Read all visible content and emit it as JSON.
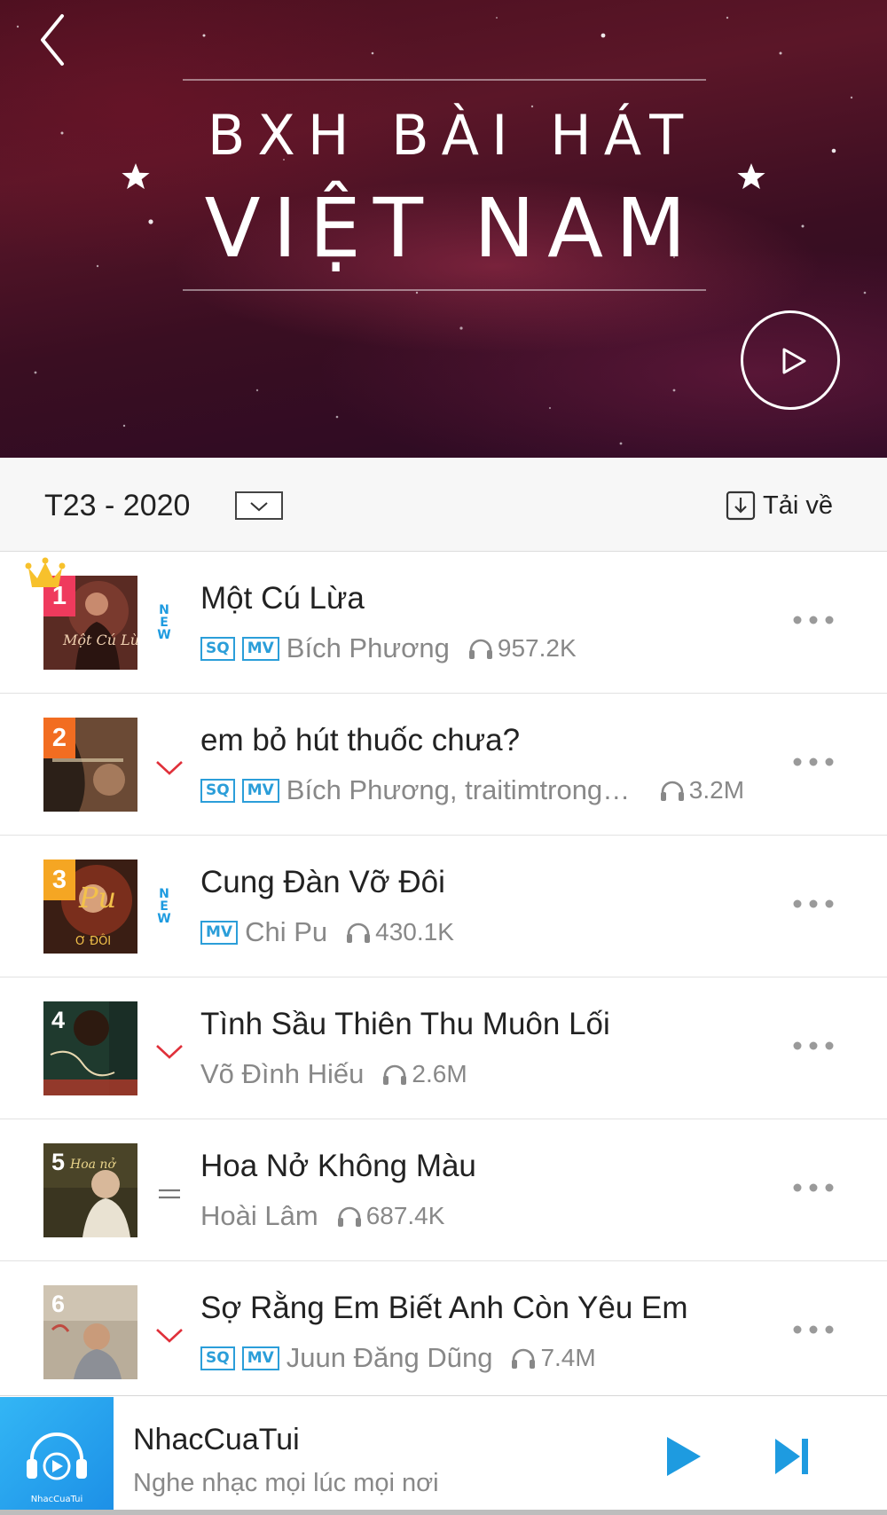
{
  "hero": {
    "title_line1": "BXH BÀI HÁT",
    "title_line2": "VIỆT NAM",
    "back_icon": "chevron-left-icon",
    "play_icon": "play-circle-icon"
  },
  "period": {
    "label": "T23 - 2020",
    "dropdown_icon": "chevron-down-icon",
    "download_label": "Tải về",
    "download_icon": "download-icon"
  },
  "songs": [
    {
      "rank": "1",
      "trend": "new",
      "title": "Một Cú Lừa",
      "tags": [
        "SQ",
        "MV"
      ],
      "artist": "Bích Phương",
      "listens": "957.2K"
    },
    {
      "rank": "2",
      "trend": "down",
      "title": "em bỏ hút thuốc chưa?",
      "tags": [
        "SQ",
        "MV"
      ],
      "artist": "Bích Phương, traitimtrongvang",
      "listens": "3.2M"
    },
    {
      "rank": "3",
      "trend": "new",
      "title": "Cung Đàn Vỡ Đôi",
      "tags": [
        "MV"
      ],
      "artist": "Chi Pu",
      "listens": "430.1K"
    },
    {
      "rank": "4",
      "trend": "down",
      "title": "Tình Sầu Thiên Thu Muôn Lối",
      "tags": [],
      "artist": "Võ Đình Hiếu",
      "listens": "2.6M"
    },
    {
      "rank": "5",
      "trend": "same",
      "title": "Hoa Nở Không Màu",
      "tags": [],
      "artist": "Hoài Lâm",
      "listens": "687.4K"
    },
    {
      "rank": "6",
      "trend": "down",
      "title": "Sợ Rằng Em Biết Anh Còn Yêu Em",
      "tags": [
        "SQ",
        "MV"
      ],
      "artist": "Juun Đăng Dũng",
      "listens": "7.4M"
    }
  ],
  "new_label": "NEW",
  "player": {
    "title": "NhacCuaTui",
    "subtitle": "Nghe nhạc mọi lúc mọi nơi",
    "logo_text": "NhacCuaTui"
  },
  "colors": {
    "accent_blue": "#1e9be0",
    "trend_down": "#e0303a",
    "rank1": "#ef3a5d",
    "rank2": "#f26d21",
    "rank3": "#f5a623",
    "crown": "#f7c12c"
  }
}
